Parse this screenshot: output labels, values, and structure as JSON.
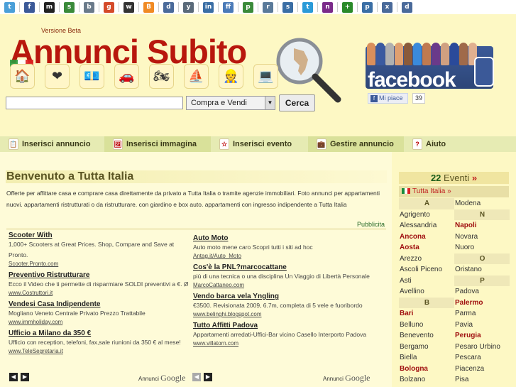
{
  "social_icons": [
    {
      "name": "twitter-icon",
      "color": "#4a9fd8",
      "glyph": "t"
    },
    {
      "name": "facebook-icon",
      "color": "#3b5998",
      "glyph": "f"
    },
    {
      "name": "myspace-icon",
      "color": "#222222",
      "glyph": "m"
    },
    {
      "name": "stumbleupon-icon",
      "color": "#3a8a3a",
      "glyph": "s"
    },
    {
      "name": "bookmark-icon",
      "color": "#6a7a8a",
      "glyph": "b"
    },
    {
      "name": "google-icon",
      "color": "#d44a2a",
      "glyph": "g"
    },
    {
      "name": "wordpress-icon",
      "color": "#333333",
      "glyph": "w"
    },
    {
      "name": "blogger-icon",
      "color": "#f08a24",
      "glyph": "B"
    },
    {
      "name": "delicious-icon",
      "color": "#4a6a9a",
      "glyph": "d"
    },
    {
      "name": "myweb-icon",
      "color": "#5a6a7a",
      "glyph": "y"
    },
    {
      "name": "linkedin-icon",
      "color": "#3a6ea5",
      "glyph": "in"
    },
    {
      "name": "friendfeed-icon",
      "color": "#4a7ab8",
      "glyph": "ff"
    },
    {
      "name": "photo-icon",
      "color": "#3a8a3a",
      "glyph": "p"
    },
    {
      "name": "reader-icon",
      "color": "#5a7a9a",
      "glyph": "r"
    },
    {
      "name": "share-icon",
      "color": "#3a6ea5",
      "glyph": "s"
    },
    {
      "name": "technorati-icon",
      "color": "#2a9ad8",
      "glyph": "t"
    },
    {
      "name": "netvibes-icon",
      "color": "#7a2a8a",
      "glyph": "n"
    },
    {
      "name": "plus-icon",
      "color": "#2a8a2a",
      "glyph": "+"
    },
    {
      "name": "pinterest-icon",
      "color": "#3a6ea5",
      "glyph": "p"
    },
    {
      "name": "mixx-icon",
      "color": "#4a6a9a",
      "glyph": "x"
    },
    {
      "name": "digg-icon",
      "color": "#4a6a9a",
      "glyph": "d"
    }
  ],
  "header": {
    "version": "Versione Beta",
    "logo_first": "A",
    "logo_rest": "nnunci Subito"
  },
  "categories": [
    {
      "name": "house-icon",
      "glyph": "🏠"
    },
    {
      "name": "heart-icon",
      "glyph": "❤"
    },
    {
      "name": "money-icon",
      "glyph": "💶"
    },
    {
      "name": "car-icon",
      "glyph": "🚗"
    },
    {
      "name": "motorbike-icon",
      "glyph": "🏍"
    },
    {
      "name": "boat-icon",
      "glyph": "⛵"
    },
    {
      "name": "worker-icon",
      "glyph": "👷"
    },
    {
      "name": "computer-icon",
      "glyph": "💻"
    }
  ],
  "search": {
    "value": "",
    "category_selected": "Compra e Vendi",
    "button_label": "Cerca"
  },
  "facebook": {
    "word": "facebook",
    "like_label": "Mi piace",
    "like_count": "39"
  },
  "nav": [
    {
      "name": "nav-inserisci-annuncio",
      "label": "Inserisci annuncio",
      "icon": "ad-icon"
    },
    {
      "name": "nav-inserisci-immagina",
      "label": "Inserisci immagina",
      "icon": "image-icon"
    },
    {
      "name": "nav-inserisci-evento",
      "label": "Inserisci evento",
      "icon": "star-icon"
    },
    {
      "name": "nav-gestire-annuncio",
      "label": "Gestire annuncio",
      "icon": "wallet-icon"
    },
    {
      "name": "nav-aiuto",
      "label": "Aiuto",
      "icon": "help-icon"
    }
  ],
  "main": {
    "welcome": "Benvenuto a Tutta Italia",
    "intro": "Offerte per affittare casa e comprare casa direttamente da privato a Tutta Italia o tramite agenzie immobiliari. Foto annunci per appartamenti nuovi. appartamenti ristrutturati o da ristrutturare. con giardino e box auto. appartamenti con ingresso indipendente a Tutta Italia",
    "pubblicita": "Pubblicita",
    "annunci_google": "Annunci",
    "google": "Google"
  },
  "ads_left": [
    {
      "title": "Scooter With",
      "desc": "1,000+ Scooters at Great Prices. Shop, Compare and Save at Pronto.",
      "url": "Scooter.Pronto.com"
    },
    {
      "title": "Preventivo Ristrutturare",
      "desc": "Ecco il Video che ti permette di risparmiare SOLDI preventivi a €. Ø",
      "url": "www.Costruttori.it"
    },
    {
      "title": "Vendesi Casa Indipendente",
      "desc": "Mogliano Veneto Centrale Privato Prezzo Trattabile",
      "url": "www.immholiday.com"
    },
    {
      "title": "Ufficio a Milano da 350 €",
      "desc": "Ufficio con reception, telefoni, fax,sale riunioni da 350 € al mese!",
      "url": "www.TeleSegretaria.it"
    }
  ],
  "ads_right": [
    {
      "title": "Auto Moto",
      "desc": "Auto moto mene caro Scopri tutti i siti ad hoc",
      "url": "Antag.it/Auto_Moto"
    },
    {
      "title": "Cos'è la PNL?marcocattane",
      "desc": "più di una tecnica o una disciplina Un Viaggio di Libertà Personale",
      "url": "MarcoCattaneo.com"
    },
    {
      "title": "Vendo barca vela Yngling",
      "desc": "€3500. Revisionata 2009, 6.7m, completa di 5 vele e fuoribordo",
      "url": "www.belinghi.blogspot.com"
    },
    {
      "title": "Tutto Affitti Padova",
      "desc": "Appartamenti arredati-Uffici-Bar vicino Casello Interporto Padova",
      "url": "www.villatorn.com"
    }
  ],
  "sidebar": {
    "eventi_count": "22",
    "eventi_label": "Eventi",
    "eventi_chev": "»",
    "tutta_label": "Tutta Italia »",
    "col1": [
      {
        "t": "A",
        "type": "letter"
      },
      {
        "t": "Agrigento"
      },
      {
        "t": "Alessandria"
      },
      {
        "t": "Ancona",
        "type": "hl"
      },
      {
        "t": "Aosta",
        "type": "hl"
      },
      {
        "t": "Arezzo"
      },
      {
        "t": "Ascoli Piceno"
      },
      {
        "t": "Asti"
      },
      {
        "t": "Avellino"
      },
      {
        "t": "B",
        "type": "letter"
      },
      {
        "t": "Bari",
        "type": "hl"
      },
      {
        "t": "Belluno"
      },
      {
        "t": "Benevento"
      },
      {
        "t": "Bergamo"
      },
      {
        "t": "Biella"
      },
      {
        "t": "Bologna",
        "type": "hl"
      },
      {
        "t": "Bolzano"
      }
    ],
    "col2": [
      {
        "t": "Modena"
      },
      {
        "t": "N",
        "type": "letter"
      },
      {
        "t": "Napoli",
        "type": "hl"
      },
      {
        "t": "Novara"
      },
      {
        "t": "Nuoro"
      },
      {
        "t": "O",
        "type": "letter"
      },
      {
        "t": "Oristano"
      },
      {
        "t": "P",
        "type": "letter"
      },
      {
        "t": "Padova"
      },
      {
        "t": "Palermo",
        "type": "hl"
      },
      {
        "t": "Parma"
      },
      {
        "t": "Pavia"
      },
      {
        "t": "Perugia",
        "type": "hl"
      },
      {
        "t": "Pesaro Urbino"
      },
      {
        "t": "Pescara"
      },
      {
        "t": "Piacenza"
      },
      {
        "t": "Pisa"
      }
    ]
  }
}
